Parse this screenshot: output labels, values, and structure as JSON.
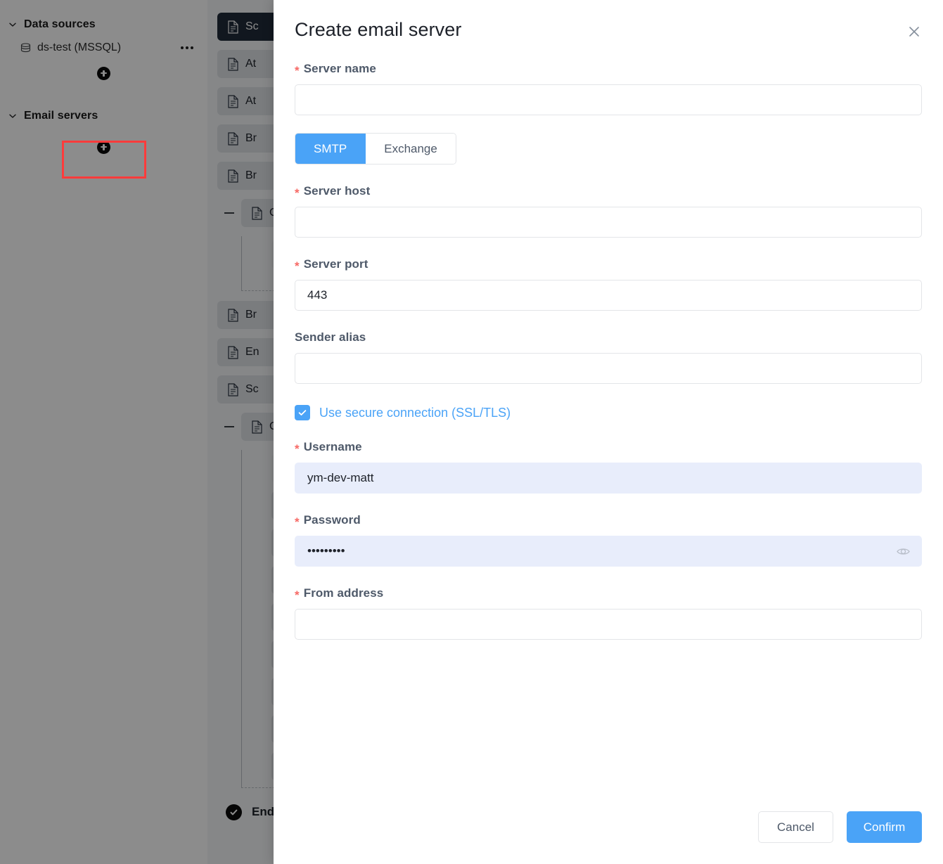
{
  "sidebar": {
    "sections": [
      {
        "label": "Data sources",
        "expanded": true,
        "items": [
          {
            "label": "ds-test (MSSQL)",
            "icon": "database-icon",
            "menu": "kebab-icon"
          }
        ],
        "add_label": "+"
      },
      {
        "label": "Email servers",
        "expanded": true,
        "items": [],
        "add_label": "+"
      }
    ]
  },
  "background_canvas": {
    "nodes": [
      {
        "label": "Sc",
        "selected": true,
        "icon": "document-icon"
      },
      {
        "label": "At",
        "selected": false,
        "icon": "document-icon"
      },
      {
        "label": "At",
        "selected": false,
        "icon": "document-icon"
      },
      {
        "label": "Br",
        "selected": false,
        "icon": "document-icon"
      },
      {
        "label": "Br",
        "selected": false,
        "icon": "document-icon"
      },
      {
        "label": "Co",
        "selected": false,
        "icon": "document-icon",
        "group": true
      },
      {
        "label": "Br",
        "selected": false,
        "icon": "document-icon"
      },
      {
        "label": "En",
        "selected": false,
        "icon": "document-icon"
      },
      {
        "label": "Sc",
        "selected": false,
        "icon": "document-icon"
      },
      {
        "label": "Co",
        "selected": false,
        "icon": "document-icon",
        "group2": true
      }
    ],
    "end_label": "End"
  },
  "modal": {
    "title": "Create email server",
    "close_icon": "close-icon",
    "fields": {
      "server_name": {
        "label": "Server name",
        "required": true,
        "value": "",
        "placeholder": ""
      },
      "server_host": {
        "label": "Server host",
        "required": true,
        "value": "",
        "placeholder": ""
      },
      "server_port": {
        "label": "Server port",
        "required": true,
        "value": "443",
        "placeholder": ""
      },
      "sender_alias": {
        "label": "Sender alias",
        "required": false,
        "value": "",
        "placeholder": ""
      },
      "username": {
        "label": "Username",
        "required": true,
        "value": "ym-dev-matt",
        "placeholder": ""
      },
      "password": {
        "label": "Password",
        "required": true,
        "value": "•••••••••",
        "placeholder": "",
        "reveal_icon": "eye-icon"
      },
      "from_address": {
        "label": "From address",
        "required": true,
        "value": "",
        "placeholder": ""
      }
    },
    "protocol": {
      "options": [
        "SMTP",
        "Exchange"
      ],
      "selected": "SMTP"
    },
    "secure_connection": {
      "label": "Use secure connection (SSL/TLS)",
      "checked": true
    },
    "required_marker": "*",
    "buttons": {
      "cancel": "Cancel",
      "confirm": "Confirm"
    }
  },
  "colors": {
    "accent": "#4aa3f7",
    "required": "#f76965",
    "highlight": "#ff3b3b",
    "filled_input_bg": "#e8edfb"
  }
}
